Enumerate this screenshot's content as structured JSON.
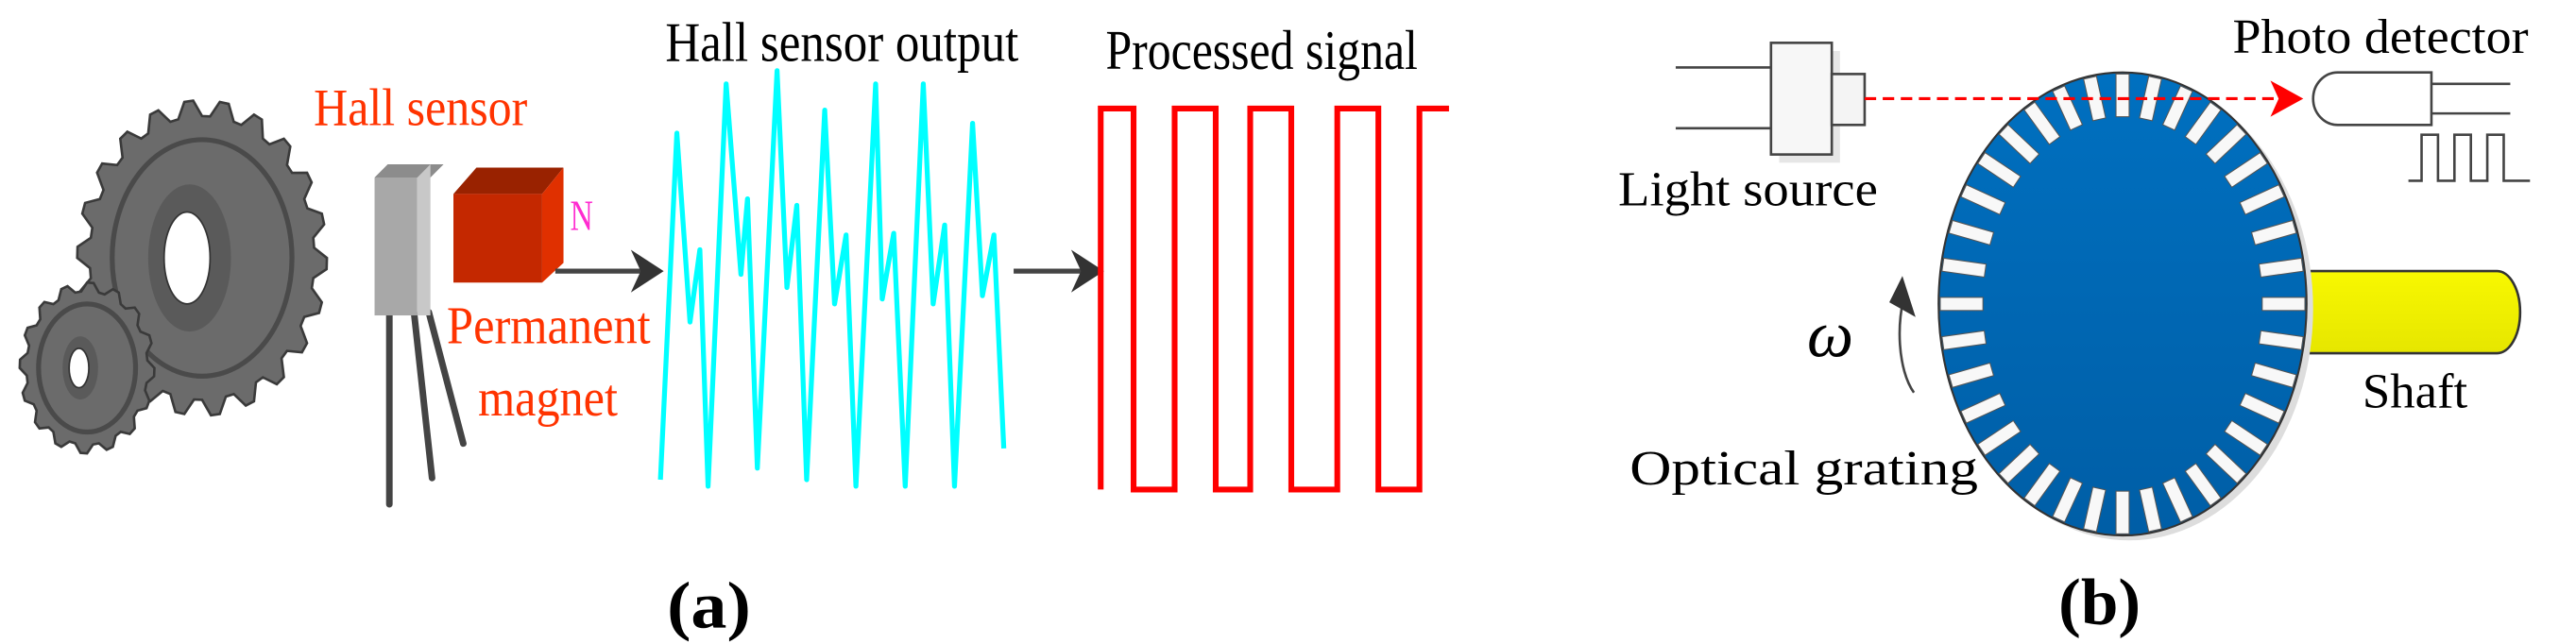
{
  "panel_a": {
    "hall_sensor_label": "Hall sensor",
    "magnet_pole_label": "N",
    "permanent_label": "Permanent",
    "magnet_label": "magnet",
    "hall_output_label": "Hall sensor output",
    "processed_signal_label": "Processed signal",
    "caption": "(a)"
  },
  "panel_b": {
    "light_source_label": "Light source",
    "photo_detector_label": "Photo detector",
    "shaft_label": "Shaft",
    "optical_grating_label": "Optical grating",
    "omega_label": "ω",
    "caption": "(b)"
  },
  "colors": {
    "label_red": "#ff3300",
    "pole_magenta": "#ff2bd0",
    "hall_wave": "#00ffff",
    "processed_wave": "#ff0000",
    "disk_blue": "#0066b3",
    "shaft_yellow": "#f2f000",
    "gear_gray": "#6b6b6b",
    "beam_red": "#ff0000"
  }
}
